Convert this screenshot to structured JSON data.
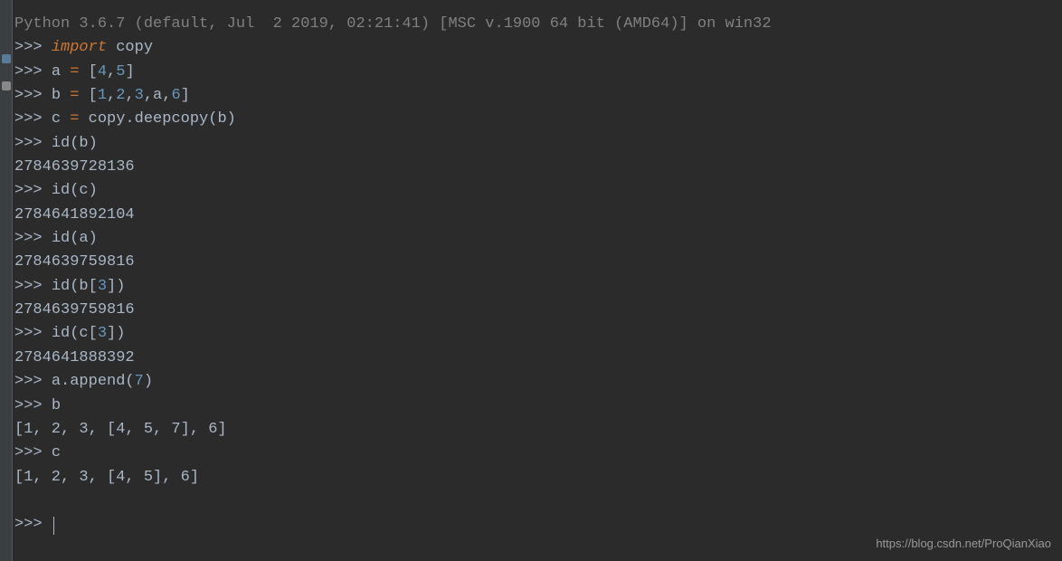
{
  "header": "Python 3.6.7 (default, Jul  2 2019, 02:21:41) [MSC v.1900 64 bit (AMD64)] on win32",
  "prompt": ">>> ",
  "lines": {
    "l1_kw": "import",
    "l1_txt": " copy",
    "l2_pre": "a ",
    "l2_eq": "=",
    "l2_post": " [",
    "l2_n1": "4",
    "l2_c1": ",",
    "l2_n2": "5",
    "l2_end": "]",
    "l3_pre": "b ",
    "l3_eq": "=",
    "l3_post": " [",
    "l3_n1": "1",
    "l3_c1": ",",
    "l3_n2": "2",
    "l3_c2": ",",
    "l3_n3": "3",
    "l3_c3": ",a,",
    "l3_n4": "6",
    "l3_end": "]",
    "l4_pre": "c ",
    "l4_eq": "=",
    "l4_post": " copy.deepcopy(b)",
    "l5": "id(b)",
    "l6": "2784639728136",
    "l7": "id(c)",
    "l8": "2784641892104",
    "l9": "id(a)",
    "l10": "2784639759816",
    "l11_pre": "id(b[",
    "l11_n": "3",
    "l11_post": "])",
    "l12": "2784639759816",
    "l13_pre": "id(c[",
    "l13_n": "3",
    "l13_post": "])",
    "l14": "2784641888392",
    "l15_pre": "a.append(",
    "l15_n": "7",
    "l15_post": ")",
    "l16": "b",
    "l17": "[1, 2, 3, [4, 5, 7], 6]",
    "l18": "c",
    "l19": "[1, 2, 3, [4, 5], 6]"
  },
  "watermark": "https://blog.csdn.net/ProQianXiao"
}
